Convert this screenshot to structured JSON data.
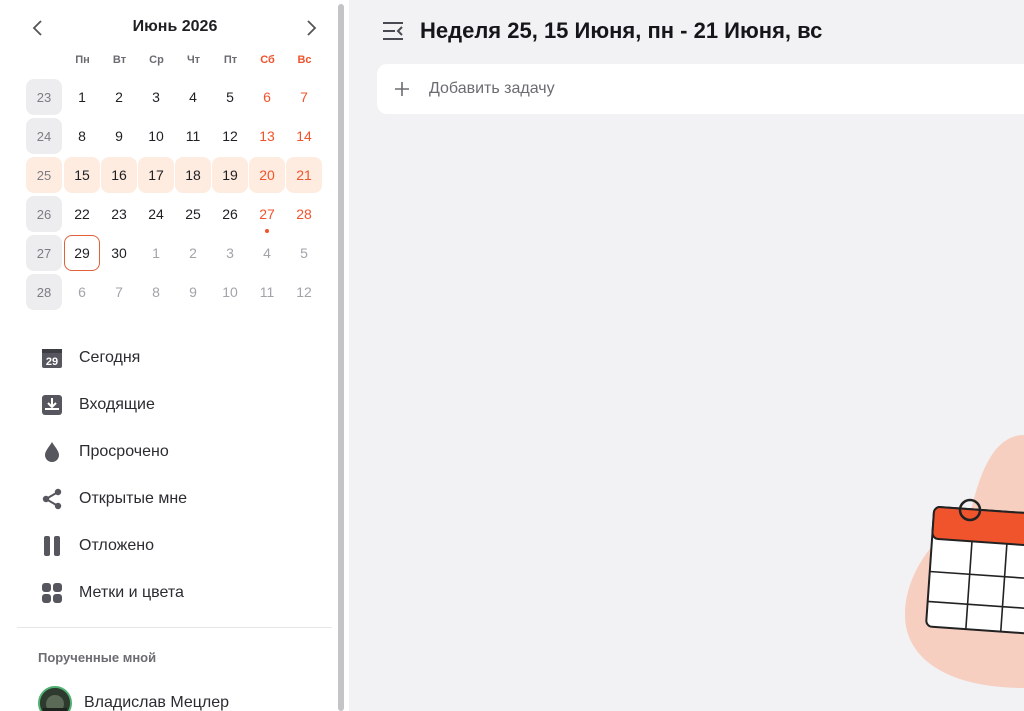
{
  "calendar": {
    "month_title": "Июнь 2026",
    "weekdays": [
      "Пн",
      "Вт",
      "Ср",
      "Чт",
      "Пт",
      "Сб",
      "Вс"
    ],
    "weeks": [
      {
        "num": "23",
        "days": [
          "1",
          "2",
          "3",
          "4",
          "5",
          "6",
          "7"
        ]
      },
      {
        "num": "24",
        "days": [
          "8",
          "9",
          "10",
          "11",
          "12",
          "13",
          "14"
        ]
      },
      {
        "num": "25",
        "days": [
          "15",
          "16",
          "17",
          "18",
          "19",
          "20",
          "21"
        ]
      },
      {
        "num": "26",
        "days": [
          "22",
          "23",
          "24",
          "25",
          "26",
          "27",
          "28"
        ]
      },
      {
        "num": "27",
        "days": [
          "29",
          "30",
          "1",
          "2",
          "3",
          "4",
          "5"
        ]
      },
      {
        "num": "28",
        "days": [
          "6",
          "7",
          "8",
          "9",
          "10",
          "11",
          "12"
        ]
      }
    ],
    "selected_week": "25",
    "today": "29"
  },
  "menu": {
    "items": [
      {
        "label": "Сегодня",
        "icon": "calendar-today-icon"
      },
      {
        "label": "Входящие",
        "icon": "inbox-icon"
      },
      {
        "label": "Просрочено",
        "icon": "drop-icon"
      },
      {
        "label": "Открытые мне",
        "icon": "share-icon"
      },
      {
        "label": "Отложено",
        "icon": "pause-icon"
      },
      {
        "label": "Метки и цвета",
        "icon": "tags-grid-icon"
      }
    ],
    "today_icon_number": "29"
  },
  "assigned": {
    "title": "Порученные мной",
    "users": [
      {
        "name": "Владислав Мецлер"
      }
    ]
  },
  "main": {
    "title": "Неделя 25, 15 Июня, пн - 21 Июня, вс",
    "add_task_placeholder": "Добавить задачу"
  },
  "colors": {
    "accent": "#f0542d",
    "week_highlight": "#fdecdf",
    "background": "#f2f2f4"
  }
}
